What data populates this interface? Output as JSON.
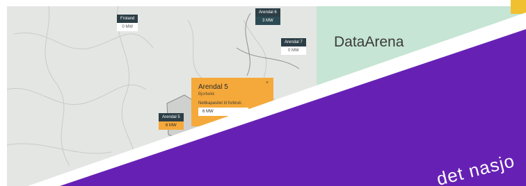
{
  "map": {
    "markers": [
      {
        "name": "Froland",
        "value": "0 MW",
        "style": "white"
      },
      {
        "name": "Arendal 6",
        "value": "3 MW",
        "style": "blue"
      },
      {
        "name": "Arendal 7",
        "value": "0 MW",
        "style": "white"
      },
      {
        "name": "Arendal 5",
        "value": "6 MW",
        "style": "orange"
      }
    ],
    "popup": {
      "title": "Arendal 5",
      "subtitle": "Bjorbekk",
      "description": "Nettkapasitet til forbruk:",
      "capacity": "6 MW",
      "close": "×"
    }
  },
  "card": {
    "title": "DataArena"
  },
  "banner": {
    "text": "det nasjo",
    "color": "#6621b4"
  },
  "colors": {
    "accent_yellow": "#f0c030",
    "card_green": "#c6e5d4",
    "popup_orange": "#f5a93a",
    "marker_dark": "#2c3e46"
  }
}
